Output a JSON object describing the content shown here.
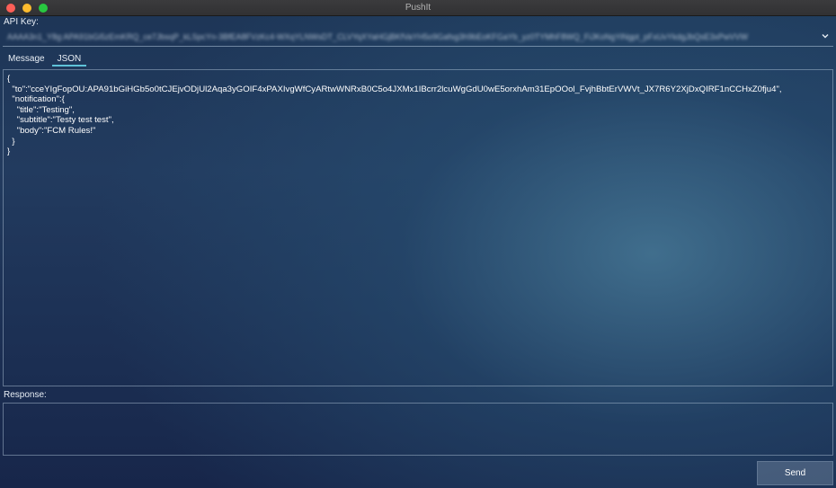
{
  "window": {
    "title": "PushIt"
  },
  "api_key": {
    "label": "API Key:",
    "value": "AAAA3n1_Y8g:APA91bGi5zEmKRQ_ce7JbsqP_kLSpcYn-3BfEA8FVzKc4-WXqYLNWsDT_CLVYqXYaHGjBKfVaYH5o9Gafsg3h9bEoKFGaYb_yz0TYMhF8WQ_FiJKoNgYiNgpt_pFxUvYkdgJbQsE3xPwVVW"
  },
  "tabs": [
    {
      "label": "Message",
      "active": false
    },
    {
      "label": "JSON",
      "active": true
    }
  ],
  "editor": {
    "content": "{\n  \"to\":\"cceYIgFopOU:APA91bGiHGb5o0tCJEjvODjUl2Aqa3yGOIF4xPAXIvgWfCyARtwWNRxB0C5o4JXMx1IBcrr2lcuWgGdU0wE5orxhAm31EpOOol_FvjhBbtErVWVt_JX7R6Y2XjDxQIRF1nCCHxZ0fju4\",\n  \"notification\":{\n    \"title\":\"Testing\",\n    \"subtitle\":\"Testy test test\",\n    \"body\":\"FCM Rules!\"\n  }\n}"
  },
  "response": {
    "label": "Response:",
    "value": ""
  },
  "send": {
    "label": "Send"
  },
  "icons": {
    "dropdown": "chevron-down-icon"
  },
  "colors": {
    "tab_underline": "#5fc3d8",
    "close": "#fe5f57",
    "minimize": "#febc2e",
    "maximize": "#28c840"
  }
}
